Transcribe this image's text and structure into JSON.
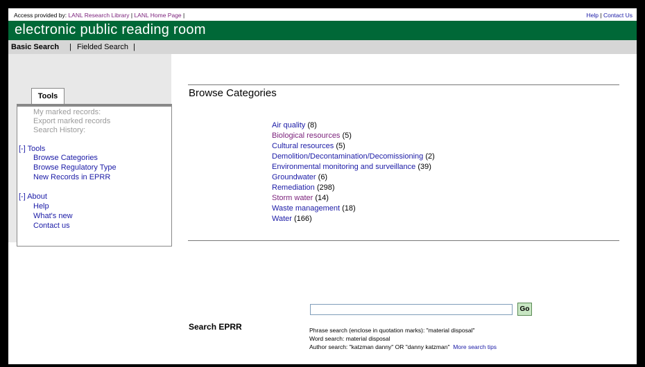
{
  "topbar": {
    "access_prefix": "Access provided by:",
    "research_library": "LANL Research Library",
    "home_page": "LANL Home Page",
    "sep": "|",
    "help": "Help",
    "contact_us": "Contact Us"
  },
  "banner": {
    "title": "electronic public reading room"
  },
  "tabs": {
    "basic": "Basic Search",
    "fielded": "Fielded Search",
    "sep": "|"
  },
  "sidebar": {
    "tools_tab": "Tools",
    "disabled_items": [
      "My marked records:",
      "Export marked records",
      "Search History:"
    ],
    "tools_header": "[-] Tools",
    "tools_items": [
      "Browse Categories",
      "Browse Regulatory Type",
      "New Records in EPRR"
    ],
    "about_header": "[-] About",
    "about_items": [
      "Help",
      "What's new",
      "Contact us"
    ]
  },
  "main": {
    "title": "Browse Categories",
    "categories": [
      {
        "label": "Air quality",
        "count": "(8)"
      },
      {
        "label": "Biological resources",
        "count": "(5)"
      },
      {
        "label": "Cultural resources",
        "count": "(5)"
      },
      {
        "label": "Demolition/Decontamination/Decomissioning",
        "count": "(2)"
      },
      {
        "label": "Environmental monitoring and surveillance",
        "count": "(39)"
      },
      {
        "label": "Groundwater",
        "count": "(6)"
      },
      {
        "label": "Remediation",
        "count": "(298)"
      },
      {
        "label": "Storm water",
        "count": "(14)"
      },
      {
        "label": "Waste management",
        "count": "(18)"
      },
      {
        "label": "Water",
        "count": "(166)"
      }
    ]
  },
  "search": {
    "label": "Search EPRR",
    "input_value": "",
    "go_label": "Go",
    "tip_phrase": "Phrase search (enclose in quotation marks): \"material disposal\"",
    "tip_word": "Word search: material disposal",
    "tip_author": "Author search: \"katzman danny\" OR \"danny katzman\"",
    "more_tips": "More search tips"
  },
  "colors": {
    "banner": "#006837",
    "link": "#1a1aa6",
    "visited_link": "#7a1f7a",
    "go_button": "#c8e6c3"
  }
}
